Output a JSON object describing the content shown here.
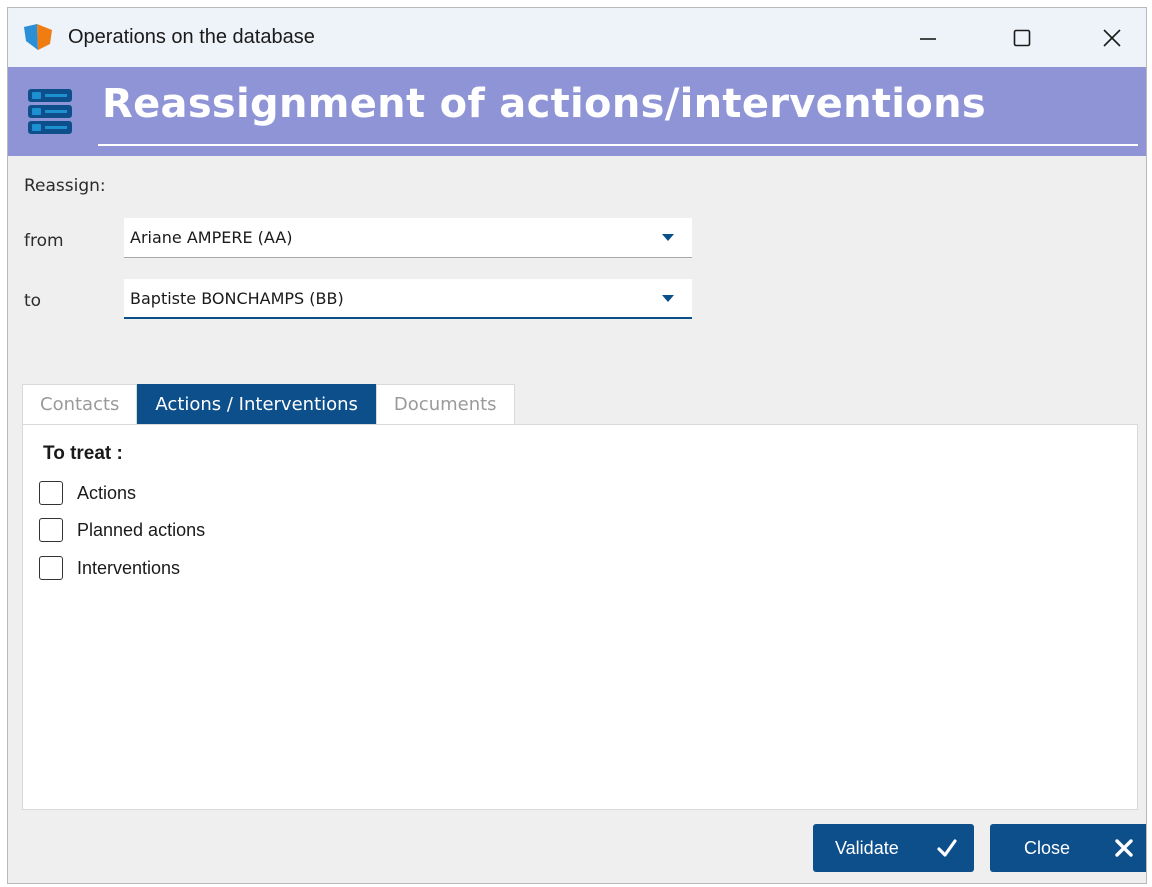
{
  "window": {
    "title": "Operations on the database",
    "app_icon": "app-logo-icon",
    "controls": [
      "minimize-icon",
      "maximize-icon",
      "close-icon"
    ]
  },
  "header": {
    "icon": "server-stack-icon",
    "title": "Reassignment of actions/interventions",
    "background": "#8e94d6"
  },
  "form": {
    "reassign_label": "Reassign:",
    "from": {
      "label": "from",
      "value": "Ariane AMPERE (AA)"
    },
    "to": {
      "label": "to",
      "value": "Baptiste BONCHAMPS (BB)"
    }
  },
  "tabs": [
    {
      "label": "Contacts",
      "active": false
    },
    {
      "label": "Actions / Interventions",
      "active": true
    },
    {
      "label": "Documents",
      "active": false
    }
  ],
  "panel": {
    "section_label": "To treat :",
    "checkboxes": [
      {
        "label": "Actions",
        "checked": false
      },
      {
        "label": "Planned actions",
        "checked": false
      },
      {
        "label": "Interventions",
        "checked": false
      }
    ]
  },
  "buttons": {
    "validate": {
      "label": "Validate",
      "icon": "checkmark-icon"
    },
    "close": {
      "label": "Close",
      "icon": "close-x-icon"
    }
  },
  "colors": {
    "accent": "#0c4f8b",
    "header": "#8e94d6"
  }
}
